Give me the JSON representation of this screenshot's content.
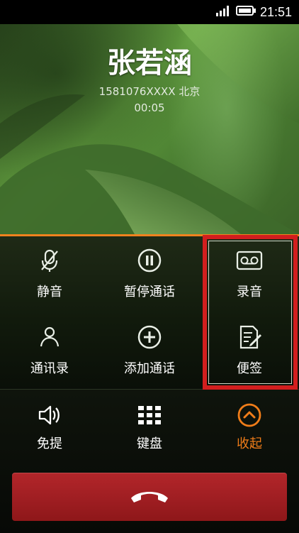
{
  "status_bar": {
    "time": "21:51",
    "icons": [
      "signal-icon",
      "battery-icon"
    ]
  },
  "caller": {
    "name": "张若涵",
    "number_location": "1581076XXXX 北京",
    "duration": "00:05"
  },
  "controls": [
    {
      "label": "静音",
      "icon": "mute-mic-icon"
    },
    {
      "label": "暂停通话",
      "icon": "pause-icon"
    },
    {
      "label": "录音",
      "icon": "record-tape-icon"
    },
    {
      "label": "通讯录",
      "icon": "contacts-icon"
    },
    {
      "label": "添加通话",
      "icon": "add-call-icon"
    },
    {
      "label": "便签",
      "icon": "note-edit-icon"
    }
  ],
  "bottom": [
    {
      "label": "免提",
      "icon": "speaker-icon"
    },
    {
      "label": "键盘",
      "icon": "keypad-icon"
    },
    {
      "label": "收起",
      "icon": "collapse-icon"
    }
  ],
  "colors": {
    "accent": "#f07d19",
    "hangup": "#a8262a",
    "highlight": "#d21e1e"
  }
}
